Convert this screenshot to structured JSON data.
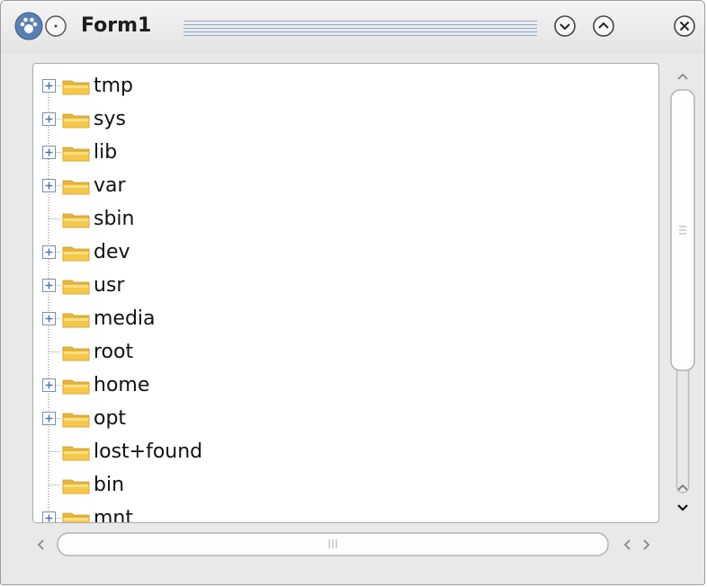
{
  "window": {
    "title": "Form1"
  },
  "tree": {
    "items": [
      {
        "label": "tmp",
        "expandable": true
      },
      {
        "label": "sys",
        "expandable": true
      },
      {
        "label": "lib",
        "expandable": true
      },
      {
        "label": "var",
        "expandable": true
      },
      {
        "label": "sbin",
        "expandable": false
      },
      {
        "label": "dev",
        "expandable": true
      },
      {
        "label": "usr",
        "expandable": true
      },
      {
        "label": "media",
        "expandable": true
      },
      {
        "label": "root",
        "expandable": false
      },
      {
        "label": "home",
        "expandable": true
      },
      {
        "label": "opt",
        "expandable": true
      },
      {
        "label": "lost+found",
        "expandable": false
      },
      {
        "label": "bin",
        "expandable": false
      },
      {
        "label": "mnt",
        "expandable": true
      }
    ]
  },
  "colors": {
    "folder": "#f5c74a",
    "expander_plus": "#4a6fa5",
    "scroll_groove": "#b8bcc0"
  },
  "icons": {
    "app": "paw-icon",
    "sticky": "circle-dot-icon",
    "minimize": "chevron-down-circle-icon",
    "maximize": "chevron-up-circle-icon",
    "close": "close-circle-icon"
  }
}
